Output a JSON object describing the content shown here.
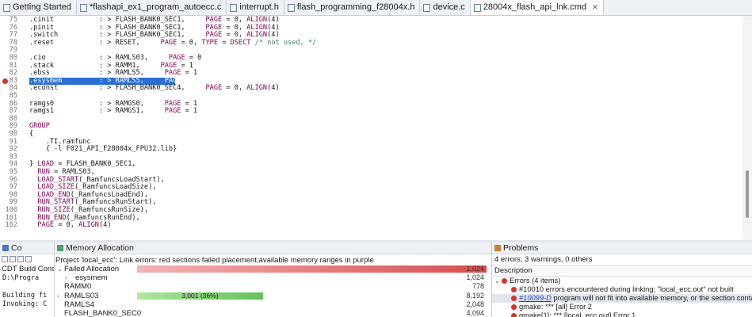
{
  "tabs": [
    {
      "label": "Getting Started",
      "active": false
    },
    {
      "label": "*flashapi_ex1_program_autoecc.c",
      "active": false
    },
    {
      "label": "interrupt.h",
      "active": false
    },
    {
      "label": "flash_programming_f28004x.h",
      "active": false
    },
    {
      "label": "device.c",
      "active": false
    },
    {
      "label": "28004x_flash_api_lnk.cmd",
      "active": true
    }
  ],
  "editor": {
    "lines": [
      {
        "n": "75",
        "text": "   .cinit           : > FLASH_BANK0_SEC1,     PAGE = 0, ALIGN(4)"
      },
      {
        "n": "76",
        "text": "   .pinit           : > FLASH_BANK0_SEC1,     PAGE = 0, ALIGN(4)"
      },
      {
        "n": "77",
        "text": "   .switch          : > FLASH_BANK0_SEC1,     PAGE = 0, ALIGN(4)"
      },
      {
        "n": "78",
        "text": "   .reset           : > RESET,     PAGE = 0, TYPE = DSECT /* not used, */"
      },
      {
        "n": "79",
        "text": ""
      },
      {
        "n": "80",
        "text": "   .cio             : > RAMLS03,     PAGE = 0"
      },
      {
        "n": "81",
        "text": "   .stack           : > RAMM1,     PAGE = 1"
      },
      {
        "n": "82",
        "text": "   .ebss            : > RAMLS5,     PAGE = 1"
      },
      {
        "n": "83",
        "text": "   .esysmem         : > RAMLS5,     PAGE = 1",
        "selected": true,
        "error": true
      },
      {
        "n": "84",
        "text": "   .econst          : > FLASH_BANK0_SEC4,     PAGE = 0, ALIGN(4)"
      },
      {
        "n": "85",
        "text": ""
      },
      {
        "n": "86",
        "text": "   ramgs0           : > RAMGS0,     PAGE = 1"
      },
      {
        "n": "87",
        "text": "   ramgs1           : > RAMGS1,     PAGE = 1"
      },
      {
        "n": "88",
        "text": ""
      },
      {
        "n": "89",
        "text": "   GROUP"
      },
      {
        "n": "90",
        "text": "   {"
      },
      {
        "n": "91",
        "text": "       .TI.ramfunc"
      },
      {
        "n": "92",
        "text": "       { -l F021_API_F28004x_FPU32.lib}"
      },
      {
        "n": "93",
        "text": ""
      },
      {
        "n": "94",
        "text": "   } LOAD = FLASH_BANK0_SEC1,"
      },
      {
        "n": "95",
        "text": "     RUN = RAMLS03,"
      },
      {
        "n": "96",
        "text": "     LOAD_START(_RamfuncsLoadStart),"
      },
      {
        "n": "97",
        "text": "     LOAD_SIZE(_RamfuncsLoadSize),"
      },
      {
        "n": "98",
        "text": "     LOAD_END(_RamfuncsLoadEnd),"
      },
      {
        "n": "99",
        "text": "     RUN_START(_RamfuncsRunStart),"
      },
      {
        "n": "100",
        "text": "     RUN_SIZE(_RamfuncsRunSize),"
      },
      {
        "n": "101",
        "text": "     RUN_END(_RamfuncsRunEnd),"
      },
      {
        "n": "102",
        "text": "     PAGE = 0, ALIGN(4)"
      }
    ]
  },
  "console": {
    "tab_label": "Co",
    "title": "CDT Build Console",
    "lines": [
      "D:\\Progra",
      "",
      "Building fi",
      "Invoking: C"
    ]
  },
  "memory": {
    "tab_label": "Memory Allocation",
    "header": "Project 'local_ecc': Link errors: red sections failed placement,available memory ranges in purple",
    "rows": [
      {
        "label": "Failed Allocation",
        "expand": "open",
        "value": "1,024",
        "fill": 1.0,
        "color": "#e25b5b",
        "indent": 0
      },
      {
        "label": "esysmem",
        "expand": "closed",
        "value": "1,024",
        "fill": 0,
        "color": "#e25b5b",
        "indent": 1
      },
      {
        "label": "RAMM0",
        "expand": "",
        "value": "778",
        "fill": 0,
        "color": "#7ccf6f",
        "indent": 0
      },
      {
        "label": "RAMLS03",
        "expand": "closed",
        "value": "8,192",
        "fill": 0.36,
        "color": "#7ccf6f",
        "bar_label": "3,001 (36%)",
        "indent": 0
      },
      {
        "label": "RAMLS4",
        "expand": "",
        "value": "2,048",
        "fill": 0,
        "color": "#7ccf6f",
        "indent": 0
      },
      {
        "label": "FLASH_BANK0_SEC0",
        "expand": "",
        "value": "4,094",
        "fill": 0,
        "color": "#7ccf6f",
        "indent": 0
      }
    ]
  },
  "problems": {
    "tab_label": "Problems",
    "summary": "4 errors, 3 warnings, 0 others",
    "col_header": "Description",
    "group": "Errors (4 items)",
    "items": [
      {
        "text": "#10010 errors encountered during linking; \"local_ecc.out\" not built",
        "selected": false
      },
      {
        "link": "#10099-D",
        "text": " program will not fit into available memory, or the section contains a ca",
        "selected": true
      },
      {
        "text": "gmake: *** [all] Error 2",
        "selected": false
      },
      {
        "text": "gmake[1]: *** [local_ecc.out] Error 1",
        "selected": false
      }
    ]
  }
}
